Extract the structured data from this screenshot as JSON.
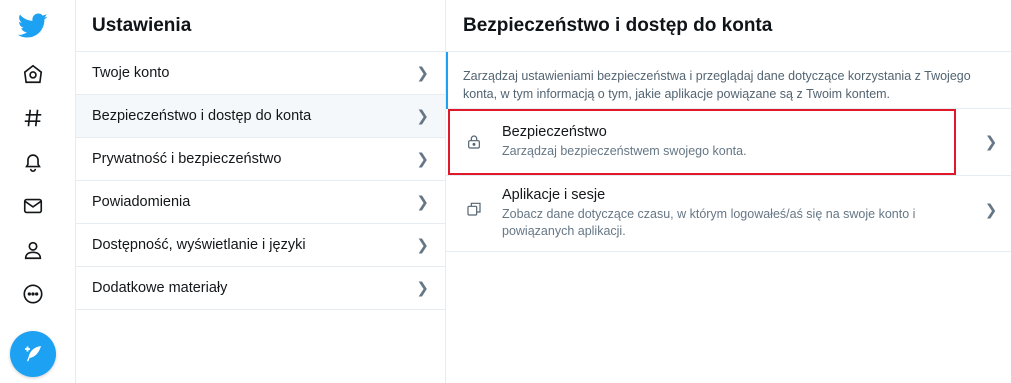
{
  "nav": {
    "items": [
      "home-icon",
      "explore-hashtag-icon",
      "notifications-bell-icon",
      "messages-envelope-icon",
      "profile-icon",
      "more-dots-icon"
    ],
    "brand_color": "#1da1f2"
  },
  "settings": {
    "title": "Ustawienia",
    "items": [
      {
        "label": "Twoje konto"
      },
      {
        "label": "Bezpieczeństwo i dostęp do konta",
        "active": true
      },
      {
        "label": "Prywatność i bezpieczeństwo"
      },
      {
        "label": "Powiadomienia"
      },
      {
        "label": "Dostępność, wyświetlanie i języki"
      },
      {
        "label": "Dodatkowe materiały"
      }
    ]
  },
  "detail": {
    "title": "Bezpieczeństwo i dostęp do konta",
    "description": "Zarządzaj ustawieniami bezpieczeństwa i przeglądaj dane dotyczące korzystania z Twojego konta, w tym informacją o tym, jakie aplikacje powiązane są z Twoim kontem.",
    "options": [
      {
        "title": "Bezpieczeństwo",
        "subtitle": "Zarządzaj bezpieczeństwem swojego konta.",
        "icon": "lock-icon",
        "highlighted": true
      },
      {
        "title": "Aplikacje i sesje",
        "subtitle": "Zobacz dane dotyczące czasu, w którym logowałeś/aś się na swoje konto i powiązanych aplikacji.",
        "icon": "copy-windows-icon"
      }
    ]
  },
  "colors": {
    "highlight": "#e0182b",
    "accent": "#1da1f2"
  }
}
